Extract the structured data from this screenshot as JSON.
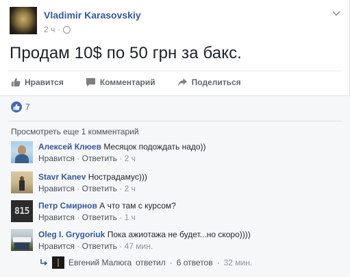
{
  "post": {
    "author": "Vladimir Karasovskiy",
    "time": "2 ч",
    "text": "Продам 10$ по 50 грн за бакс."
  },
  "actions": {
    "like": "Нравится",
    "comment": "Комментарий",
    "share": "Поделиться"
  },
  "likes_count": "7",
  "view_more": "Просмотреть еще 1 комментарий",
  "comments": [
    {
      "name": "Алексей Клюев",
      "text": "Месяцок подождать надо))",
      "like": "Нравится",
      "reply": "Ответить",
      "time": "2 ч"
    },
    {
      "name": "Stavr Kanev",
      "text": "Нострадамус)))",
      "like": "Нравится",
      "reply": "Ответить",
      "time": "2 ч"
    },
    {
      "name": "Петр Смирнов",
      "text": "А что там с курсом?",
      "like": "Нравится",
      "reply": "Ответить",
      "time": "1 ч"
    },
    {
      "name": "Oleg I. Grygoriuk",
      "text": "Пока ажиотажа не будет...но скоро))))",
      "like": "Нравится",
      "reply": "Ответить",
      "time": "47 мин."
    }
  ],
  "avatar_text_815": "815",
  "reply_summary": {
    "author": "Евгений Малюга",
    "verb": "ответил",
    "count": "6 ответов",
    "time": "32 мин."
  },
  "colors": {
    "link": "#365899",
    "like_badge": "#4267b2",
    "muted": "#90949c"
  }
}
